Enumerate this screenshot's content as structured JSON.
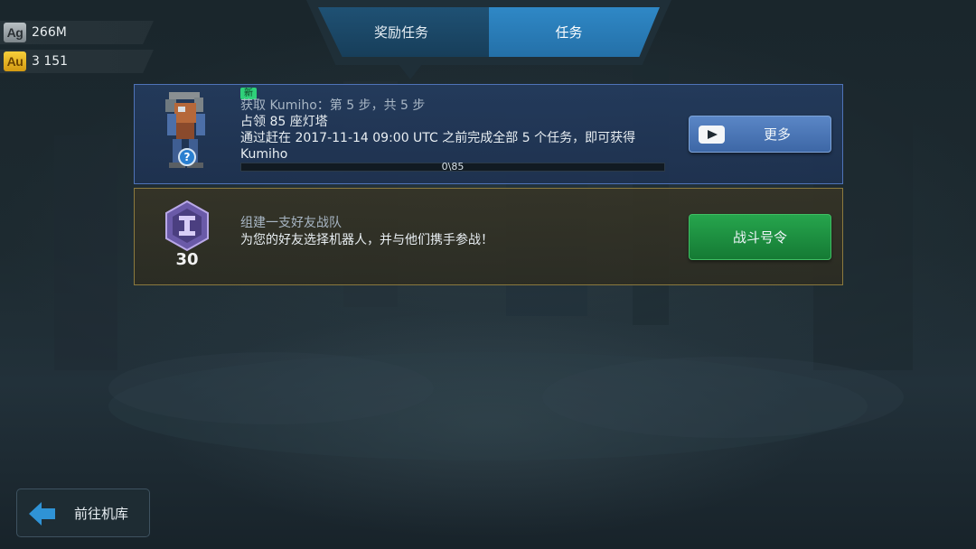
{
  "currency": {
    "silver": {
      "symbol": "Ag",
      "amount": "266M"
    },
    "gold": {
      "symbol": "Au",
      "amount": "3 151"
    }
  },
  "tabs": [
    {
      "label": "奖励任务",
      "active": false
    },
    {
      "label": "任务",
      "active": true
    }
  ],
  "tasks": [
    {
      "badge": "新",
      "subtitle": "获取 Kumiho：第 5 步，共 5 步",
      "title": "占领 85 座灯塔",
      "description": "通过赶在 2017-11-14 09:00 UTC 之前完成全部 5 个任务，即可获得 Kumiho",
      "progress_text": "0\\85",
      "progress": 0,
      "button_label": "更多",
      "button_icon": "video-play-icon"
    },
    {
      "subtitle": "组建一支好友战队",
      "description": "为您的好友选择机器人，并与他们携手参战！",
      "reward_count": "30",
      "reward_icon": "hexagon-medal-icon",
      "button_label": "战斗号令"
    }
  ],
  "back_button": {
    "label": "前往机库",
    "icon": "arrow-left-icon"
  },
  "colors": {
    "tab_active": "#2f88c6",
    "tab_inactive": "#1f5174",
    "more_button": "#4a78b8",
    "battle_button": "#1f8f40",
    "card1_border": "#4f73b8",
    "card2_border": "#8c7a3e",
    "new_badge": "#2fd07a"
  }
}
